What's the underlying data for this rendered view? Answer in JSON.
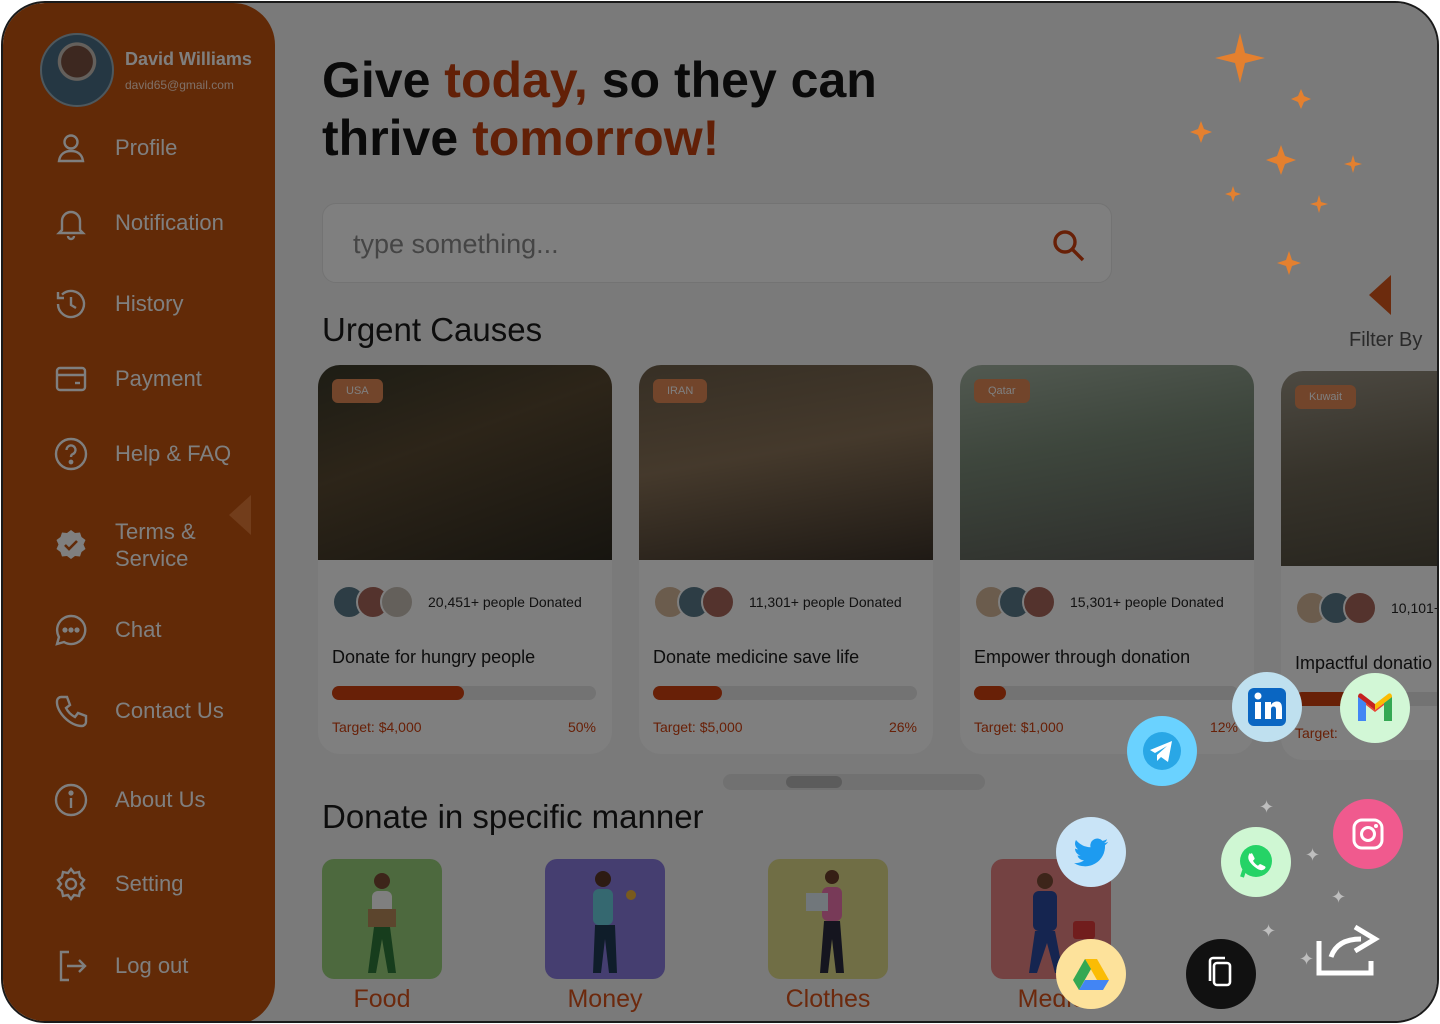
{
  "user": {
    "name": "David Williams",
    "email": "david65@gmail.com"
  },
  "menu": [
    {
      "id": "profile",
      "label": "Profile",
      "icon": "user-icon"
    },
    {
      "id": "notification",
      "label": "Notification",
      "icon": "bell-icon"
    },
    {
      "id": "history",
      "label": "History",
      "icon": "history-icon"
    },
    {
      "id": "payment",
      "label": "Payment",
      "icon": "card-icon"
    },
    {
      "id": "help",
      "label": "Help & FAQ",
      "icon": "help-icon"
    },
    {
      "id": "terms",
      "label_line1": "Terms &",
      "label_line2": "Service",
      "icon": "badge-check-icon"
    },
    {
      "id": "chat",
      "label": "Chat",
      "icon": "chat-icon"
    },
    {
      "id": "contact",
      "label": "Contact Us",
      "icon": "phone-icon"
    },
    {
      "id": "about",
      "label": "About Us",
      "icon": "info-icon"
    },
    {
      "id": "setting",
      "label": "Setting",
      "icon": "gear-icon"
    },
    {
      "id": "logout",
      "label": "Log out",
      "icon": "logout-icon"
    }
  ],
  "headline": {
    "line1_a": "Give ",
    "line1_accent": "today,",
    "line1_b": " so they can",
    "line2_a": "thrive ",
    "line2_accent": "tomorrow!"
  },
  "search": {
    "placeholder": "type something..."
  },
  "urgent": {
    "title": "Urgent Causes",
    "filter_label": "Filter By",
    "cards": [
      {
        "country": "USA",
        "donated": "20,451+ people Donated",
        "title": "Donate for hungry people",
        "target": "Target: $4,000",
        "percent": "50%",
        "progress": 0.5
      },
      {
        "country": "IRAN",
        "donated": "11,301+ people Donated",
        "title": "Donate medicine save life",
        "target": "Target: $5,000",
        "percent": "26%",
        "progress": 0.26
      },
      {
        "country": "Qatar",
        "donated": "15,301+ people Donated",
        "title": "Empower through donation",
        "target": "Target: $1,000",
        "percent": "12%",
        "progress": 0.12
      },
      {
        "country": "Kuwait",
        "donated": "10,101+",
        "title": "Impactful donatio",
        "target": "Target:",
        "percent": "",
        "progress": 0.3
      }
    ]
  },
  "manner": {
    "title": "Donate in specific manner",
    "items": [
      {
        "label": "Food",
        "color": "#9ad37d"
      },
      {
        "label": "Money",
        "color": "#8b7de0"
      },
      {
        "label": "Clothes",
        "color": "#e0dc8a"
      },
      {
        "label": "Medic",
        "color": "#e88585"
      }
    ]
  },
  "share_targets": [
    "linkedin",
    "gmail",
    "telegram",
    "instagram",
    "twitter",
    "whatsapp",
    "google-drive",
    "copy-link"
  ],
  "colors": {
    "brand": "#c4540f",
    "accent": "#c4400f",
    "overlay": "rgba(0,0,0,0.5)"
  }
}
